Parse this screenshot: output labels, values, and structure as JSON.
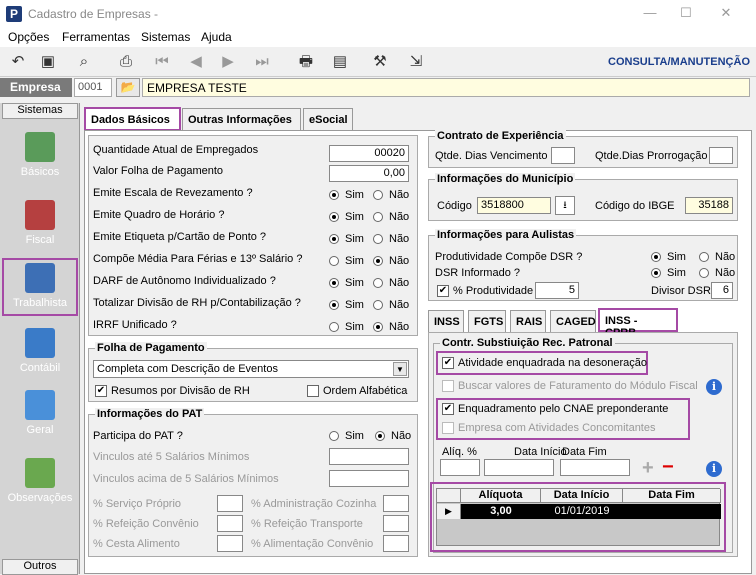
{
  "window": {
    "title": "Cadastro de Empresas -",
    "app_icon": "P",
    "mode_label": "CONSULTA/MANUTENÇÃO"
  },
  "menu": [
    "Opções",
    "Ferramentas",
    "Sistemas",
    "Ajuda"
  ],
  "empresa": {
    "label": "Empresa",
    "code": "0001",
    "name": "EMPRESA TESTE"
  },
  "sidebar": {
    "header": "Sistemas",
    "footer": "Outros",
    "items": [
      {
        "label": "Básicos",
        "icon": "document-chart-icon"
      },
      {
        "label": "Fiscal",
        "icon": "cash-register-icon"
      },
      {
        "label": "Trabalhista",
        "icon": "worker-icon"
      },
      {
        "label": "Contábil",
        "icon": "ledger-icon"
      },
      {
        "label": "Geral",
        "icon": "computer-icon"
      },
      {
        "label": "Observações",
        "icon": "pen-check-icon"
      }
    ]
  },
  "tabs": [
    "Dados Básicos",
    "Outras Informações",
    "eSocial"
  ],
  "left": {
    "rows": [
      {
        "label": "Quantidade Atual de Empregados",
        "value": "00020"
      },
      {
        "label": "Valor Folha de Pagamento",
        "value": "0,00"
      }
    ],
    "radios": [
      {
        "label": "Emite Escala de Revezamento ?",
        "selected": "Sim"
      },
      {
        "label": "Emite Quadro de Horário ?",
        "selected": "Sim"
      },
      {
        "label": "Emite Etiqueta p/Cartão de Ponto ?",
        "selected": "Sim"
      },
      {
        "label": "Compõe Média Para Férias e 13º Salário ?",
        "selected": "Não"
      },
      {
        "label": "DARF de Autônomo Individualizado ?",
        "selected": "Sim"
      },
      {
        "label": "Totalizar Divisão de RH p/Contabilização ?",
        "selected": "Sim"
      },
      {
        "label": "IRRF Unificado ?",
        "selected": "Não"
      }
    ],
    "sim": "Sim",
    "nao": "Não"
  },
  "folha": {
    "title": "Folha de Pagamento",
    "select": "Completa com Descrição de Eventos",
    "resumos": "Resumos por Divisão de RH",
    "ordem": "Ordem Alfabética"
  },
  "pat": {
    "title": "Informações do PAT",
    "participa": "Participa do PAT ?",
    "vinc5": "Vinculos até 5 Salários Mínimos",
    "vincAcima": "Vinculos acima de 5 Salários Mínimos",
    "servico": "% Serviço Próprio",
    "refConv": "% Refeição Convênio",
    "cesta": "% Cesta Alimento",
    "admCoz": "% Administração Cozinha",
    "refTransp": "% Refeição Transporte",
    "alimConv": "% Alimentação Convênio"
  },
  "contrato": {
    "title": "Contrato de Experiência",
    "venc": "Qtde. Dias Vencimento",
    "prorr": "Qtde.Dias Prorrogação"
  },
  "municipio": {
    "title": "Informações do Município",
    "codigo_label": "Código",
    "codigo": "3518800",
    "ibge_label": "Código do IBGE",
    "ibge": "35188"
  },
  "aulistas": {
    "title": "Informações para Aulistas",
    "prod": "Produtividade Compõe DSR ?",
    "dsr": "DSR Informado ?",
    "pct_label": "% Produtividade",
    "pct": "5",
    "div_label": "Divisor DSR",
    "div": "6"
  },
  "subtabs": [
    "INSS",
    "FGTS",
    "RAIS",
    "CAGED",
    "INSS - CPRB"
  ],
  "cprb": {
    "title": "Contr. Substiuição Rec. Patronal",
    "ativ": "Atividade enquadrada na desoneração",
    "buscar": "Buscar valores de Faturamento do Módulo Fiscal",
    "enq": "Enquadramento pelo CNAE preponderante",
    "emp": "Empresa com Atividades Concomitantes",
    "aliq_label": "Alíq. %",
    "ini_label": "Data Início",
    "fim_label": "Data Fim",
    "grid_headers": [
      "Alíquota",
      "Data Início",
      "Data Fim"
    ],
    "grid_row": [
      "3,00",
      "01/01/2019",
      ""
    ]
  }
}
